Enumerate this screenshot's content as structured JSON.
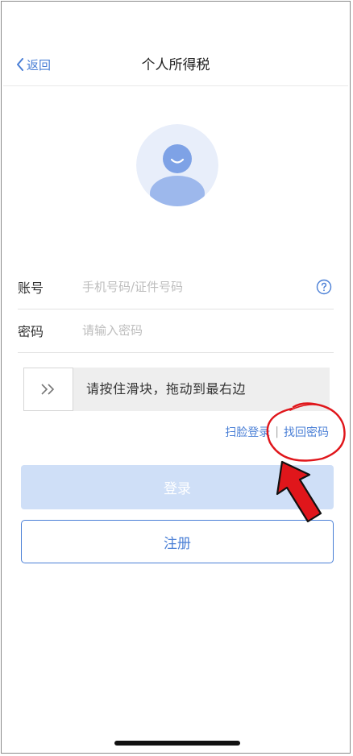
{
  "header": {
    "back_label": "返回",
    "title": "个人所得税"
  },
  "form": {
    "account": {
      "label": "账号",
      "placeholder": "手机号码/证件号码"
    },
    "password": {
      "label": "密码",
      "placeholder": "请输入密码"
    }
  },
  "slider": {
    "handle_glyph": ">>",
    "instruction": "请按住滑块，拖动到最右边"
  },
  "links": {
    "face_login": "扫脸登录",
    "separator": "|",
    "recover_password": "找回密码"
  },
  "buttons": {
    "login": "登录",
    "register": "注册"
  },
  "colors": {
    "accent": "#4a7fd6",
    "login_disabled_bg": "#cfdff7",
    "annotation_red": "#e0161b"
  }
}
